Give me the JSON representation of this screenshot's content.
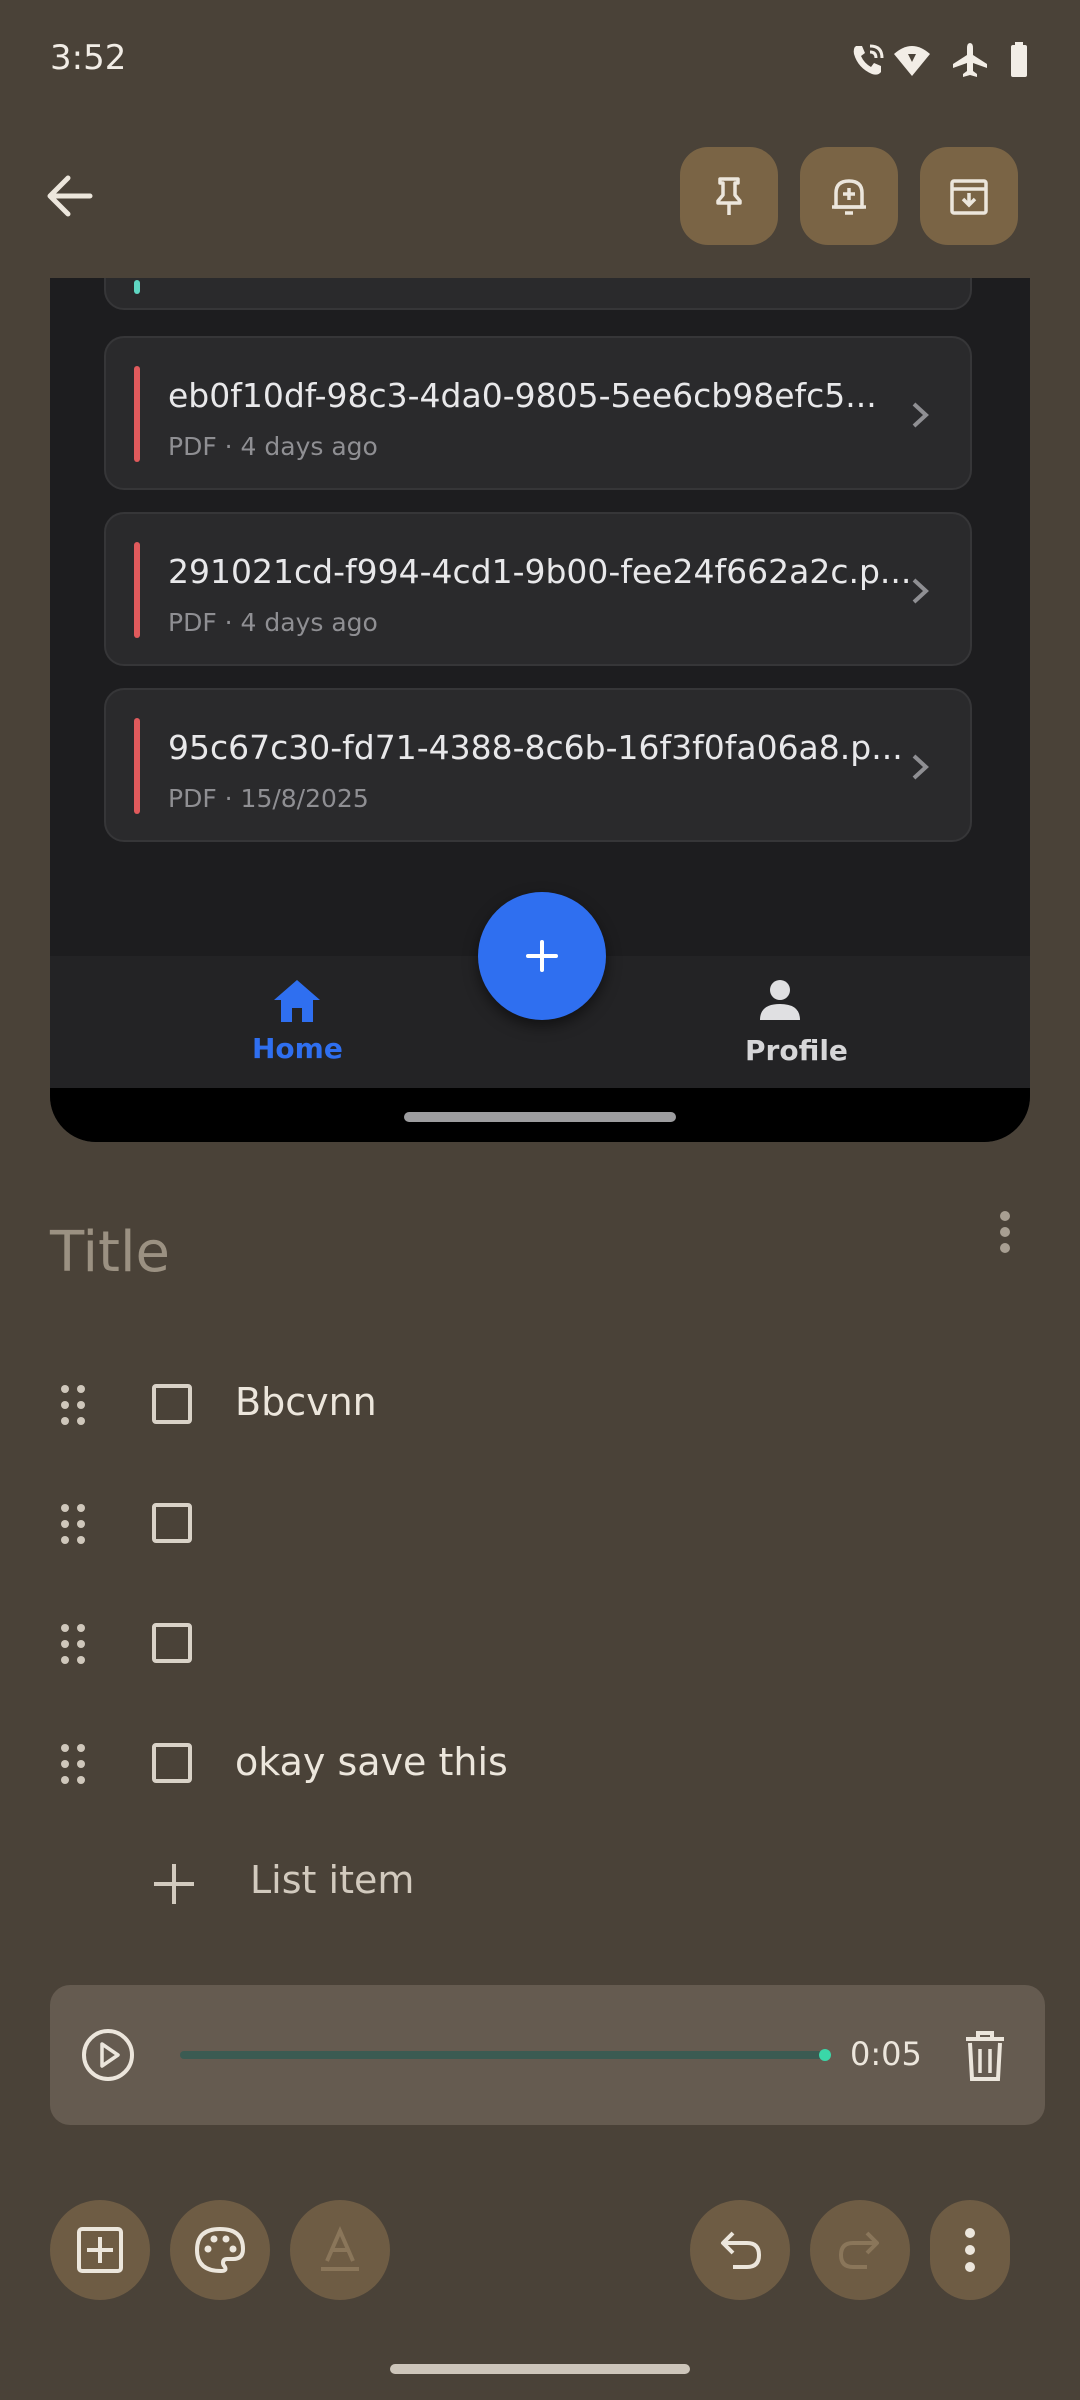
{
  "status_bar": {
    "time": "3:52",
    "icons": [
      "wifi-calling-icon",
      "wifi-icon",
      "airplane-icon",
      "battery-icon"
    ]
  },
  "toolbar": {
    "icons": [
      "back-arrow-icon",
      "pin-icon",
      "reminder-icon",
      "archive-icon"
    ]
  },
  "embedded_screenshot": {
    "files": [
      {
        "name": "eb0f10df-98c3-4da0-9805-5ee6cb98efc5...",
        "meta": "PDF · 4 days ago"
      },
      {
        "name": "291021cd-f994-4cd1-9b00-fee24f662a2c.p...",
        "meta": "PDF · 4 days ago"
      },
      {
        "name": "95c67c30-fd71-4388-8c6b-16f3f0fa06a8.p...",
        "meta": "PDF · 15/8/2025"
      }
    ],
    "nav": {
      "home": "Home",
      "profile": "Profile"
    },
    "accent": "#2f6ff0"
  },
  "note": {
    "title_placeholder": "Title",
    "items": [
      {
        "text": "Bbcvnn",
        "checked": false
      },
      {
        "text": "",
        "checked": false
      },
      {
        "text": "",
        "checked": false
      },
      {
        "text": "okay save this",
        "checked": false
      }
    ],
    "add_item_label": "List item"
  },
  "audio": {
    "time": "0:05",
    "progress": 1.0
  },
  "bottom_bar": {
    "icons": [
      "add-box-icon",
      "palette-icon",
      "text-format-icon",
      "undo-icon",
      "redo-icon",
      "more-vert-icon"
    ]
  }
}
